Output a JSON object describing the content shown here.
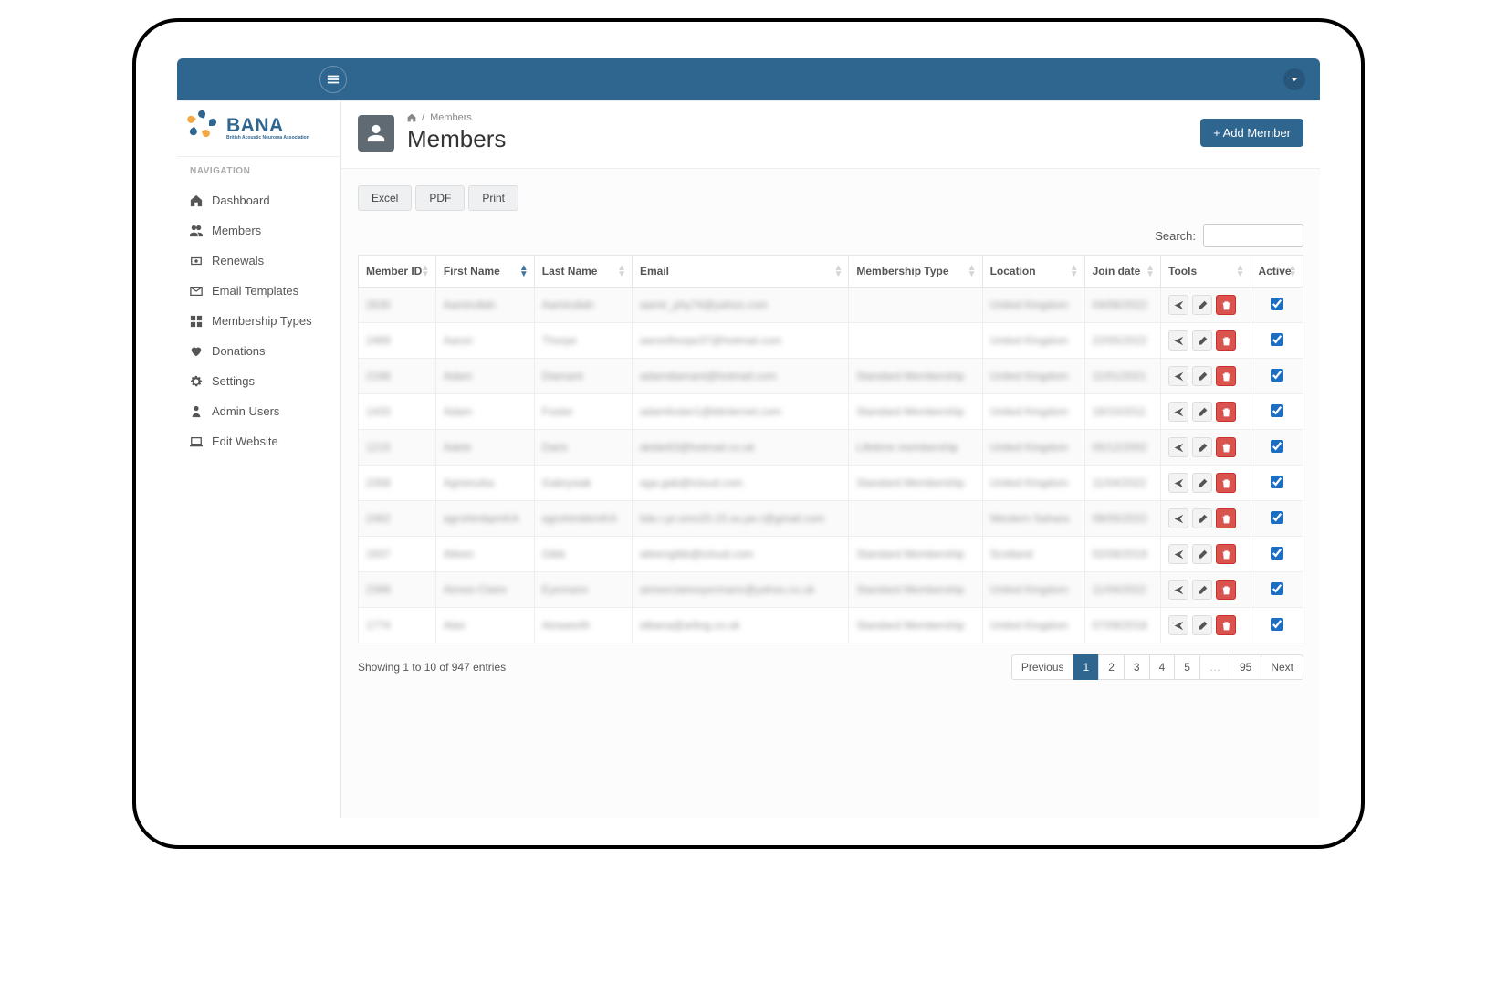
{
  "brand": {
    "name": "BANA",
    "tagline": "British Acoustic Neuroma Association"
  },
  "topbar": {},
  "sidebar": {
    "header": "NAVIGATION",
    "items": [
      {
        "label": "Dashboard",
        "icon": "home"
      },
      {
        "label": "Members",
        "icon": "users"
      },
      {
        "label": "Renewals",
        "icon": "renew"
      },
      {
        "label": "Email Templates",
        "icon": "mail"
      },
      {
        "label": "Membership Types",
        "icon": "grid"
      },
      {
        "label": "Donations",
        "icon": "heart"
      },
      {
        "label": "Settings",
        "icon": "gear"
      },
      {
        "label": "Admin Users",
        "icon": "admin"
      },
      {
        "label": "Edit Website",
        "icon": "laptop"
      }
    ]
  },
  "breadcrumb": {
    "home": "Home",
    "current": "Members"
  },
  "page": {
    "title": "Members",
    "add_button": "+ Add Member"
  },
  "export": {
    "excel": "Excel",
    "pdf": "PDF",
    "print": "Print"
  },
  "search": {
    "label": "Search:",
    "value": ""
  },
  "table": {
    "columns": [
      "Member ID",
      "First Name",
      "Last Name",
      "Email",
      "Membership Type",
      "Location",
      "Join date",
      "Tools",
      "Active"
    ],
    "rows": [
      {
        "id": "2630",
        "first": "Aamirullah",
        "last": "Aamirullah",
        "email": "aamir_phy74@yahoo.com",
        "type": "",
        "location": "United Kingdom",
        "date": "04/06/2022",
        "active": true
      },
      {
        "id": "2489",
        "first": "Aaron",
        "last": "Thorpe",
        "email": "aaronthorpe37@hotmail.com",
        "type": "",
        "location": "United Kingdom",
        "date": "22/05/2022",
        "active": true
      },
      {
        "id": "2168",
        "first": "Adam",
        "last": "Diamant",
        "email": "adamdiamant@hotmail.com",
        "type": "Standard Membership",
        "location": "United Kingdom",
        "date": "11/01/2021",
        "active": true
      },
      {
        "id": "1433",
        "first": "Adam",
        "last": "Foster",
        "email": "adamfoster1@btinternet.com",
        "type": "Standard Membership",
        "location": "United Kingdom",
        "date": "18/10/2011",
        "active": true
      },
      {
        "id": "1215",
        "first": "Adele",
        "last": "Daris",
        "email": "delde63@hotmail.co.uk",
        "type": "Lifetime membership",
        "location": "United Kingdom",
        "date": "05/12/2002",
        "active": true
      },
      {
        "id": "2358",
        "first": "Agnieszka",
        "last": "Gabrysiak",
        "email": "aga.gab@icloud.com",
        "type": "Standard Membership",
        "location": "United Kingdom",
        "date": "11/04/2022",
        "active": true
      },
      {
        "id": "2462",
        "first": "agrohimbpmKA",
        "last": "agrohimbkmKA",
        "email": "lide.r.pr.omo20.15.su.pe.r@gmail.com",
        "type": "",
        "location": "Western Sahara",
        "date": "08/05/2022",
        "active": true
      },
      {
        "id": "1937",
        "first": "Aileen",
        "last": "Gibb",
        "email": "aileengibb@icloud.com",
        "type": "Standard Membership",
        "location": "Scotland",
        "date": "02/08/2019",
        "active": true
      },
      {
        "id": "2368",
        "first": "Aimee-Claire",
        "last": "Eyemann",
        "email": "aimeeclaireeyermann@yahoo.co.uk",
        "type": "Standard Membership",
        "location": "United Kingdom",
        "date": "11/04/2022",
        "active": true
      },
      {
        "id": "1774",
        "first": "Alan",
        "last": "Ainsworth",
        "email": "idbana@arling.co.uk",
        "type": "Standard Membership",
        "location": "United Kingdom",
        "date": "07/09/2018",
        "active": true
      }
    ]
  },
  "footer": {
    "info": "Showing 1 to 10 of 947 entries"
  },
  "pager": {
    "previous": "Previous",
    "pages": [
      "1",
      "2",
      "3",
      "4",
      "5",
      "…",
      "95"
    ],
    "next": "Next",
    "active": "1"
  },
  "colors": {
    "accent": "#2f6690",
    "danger": "#d9534f"
  }
}
